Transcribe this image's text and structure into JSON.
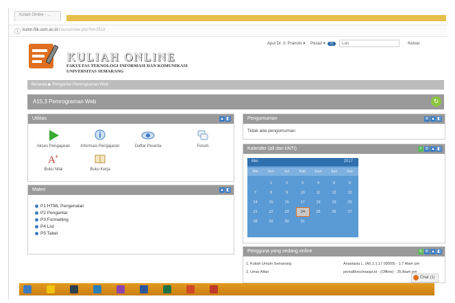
{
  "browser": {
    "tab_title": "Kuliah Online - ...",
    "url_host": "kulon.ftik.usm.ac.id",
    "url_path": "/course/view.php?id=3518"
  },
  "site": {
    "title": "KULIAH ONLINE",
    "line1": "FAKULTAS TEKNOLOGI INFORMASI DAN KOMUNIKASI",
    "line2": "UNIVERSITAS SEMARANG"
  },
  "topnav": {
    "user": "Apul Dr. Ir. Pranoto ▾",
    "messages_label": "Pesan ▾",
    "messages_count": "0",
    "search_placeholder": "Cari",
    "search_button": "Keluar"
  },
  "breadcrumb": "Beranda ▶ Pengantar Pemrograman Web",
  "page_title": "A15.3 Pemrograman Web",
  "blocks": {
    "nav": {
      "title": "Utilitas",
      "items": [
        {
          "label": "Akses Pengajaran",
          "icon": "play-icon"
        },
        {
          "label": "Informasi Pengajaran",
          "icon": "info-icon"
        },
        {
          "label": "Daftar Peserta",
          "icon": "eye-icon"
        },
        {
          "label": "Forum",
          "icon": "forum-icon"
        },
        {
          "label": "Buku Nilai",
          "icon": "grade-icon"
        },
        {
          "label": "Buku Kerja",
          "icon": "book-icon"
        }
      ]
    },
    "modules": {
      "title": "Materi",
      "items": [
        "P1 HTML Pengenalan",
        "P2 Pengantar",
        "P3 Formatting",
        "P4 List",
        "P5 Tabel"
      ]
    },
    "announce": {
      "title": "Pengumuman",
      "text": "Tidak ada pengumuman"
    },
    "calendar": {
      "title": "Kalender (all dan kNTI)",
      "month": "Mei",
      "year": "2017",
      "dows": [
        "Min",
        "Sen",
        "Sel",
        "Rab",
        "Kam",
        "Jum",
        "Sab"
      ],
      "days": [
        "1",
        "2",
        "3",
        "4",
        "5",
        "6",
        "7",
        "8",
        "9",
        "10",
        "11",
        "12",
        "13",
        "14",
        "15",
        "16",
        "17",
        "18",
        "19",
        "20",
        "21",
        "22",
        "23",
        "24",
        "25",
        "26",
        "27",
        "28",
        "29",
        "30",
        "31"
      ],
      "today": "24"
    },
    "online": {
      "title": "Pengguna yang sedang online",
      "rows": [
        {
          "left": "1. Kuliah Umum Semarang",
          "right": "Anastasia L. (A5.1.1.17.09009) · 1.7 Alam pm"
        },
        {
          "left": "2. Umar Alfan",
          "right": "pentafibrocheaspi.id · (Offline) · 35 Alam pm"
        }
      ]
    }
  },
  "chat_label": "Chat (1)",
  "colors": {
    "accent_orange": "#e07020",
    "bar_grey": "#9a9a9a",
    "calendar_blue": "#5b9bd5",
    "loading_bar": "#e6c04a",
    "taskbar": "#d48a18"
  }
}
